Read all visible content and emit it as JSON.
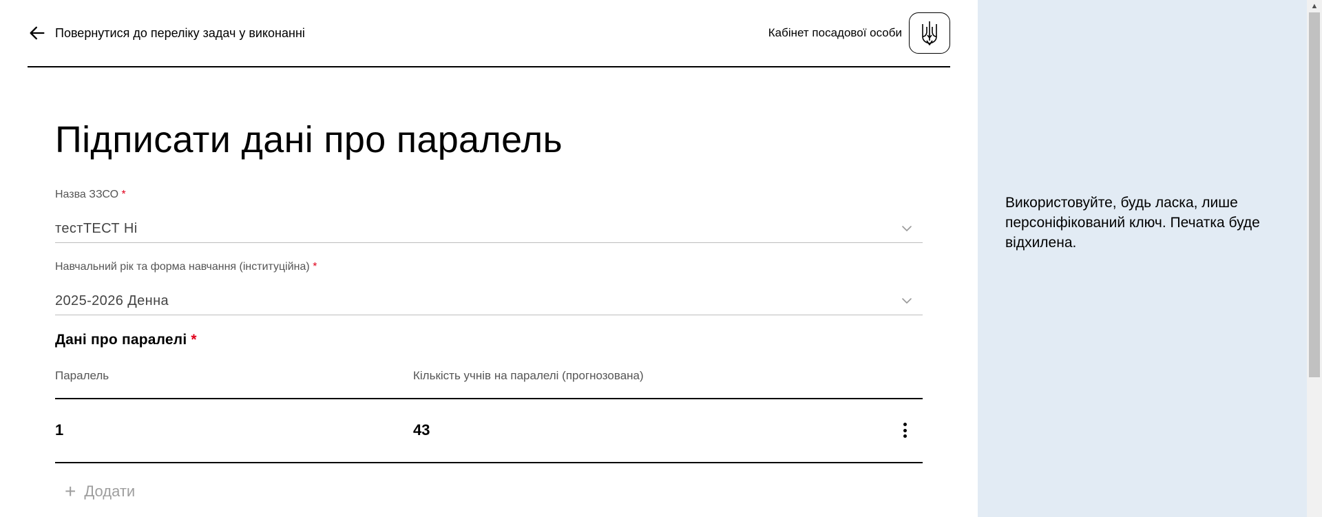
{
  "header": {
    "back_label": "Повернутися до переліку задач у виконанні",
    "cabinet_label": "Кабінет посадової особи"
  },
  "page": {
    "title": "Підписати дані про паралель"
  },
  "form": {
    "school": {
      "label": "Назва ЗЗСО",
      "required_mark": "*",
      "value": "тестТЕСТ Ні"
    },
    "year": {
      "label": "Навчальний рік та форма навчання (інституційна)",
      "required_mark": "*",
      "value": "2025-2026 Денна"
    }
  },
  "parallels": {
    "title": "Дані про паралелі",
    "required_mark": "*",
    "columns": [
      "Паралель",
      "Кількість учнів на паралелі (прогнозована)"
    ],
    "rows": [
      {
        "parallel": "1",
        "students": "43"
      }
    ],
    "add_label": "Додати"
  },
  "sidebar": {
    "note": "Використовуйте, будь ласка, лише персоніфікований ключ. Печатка буде відхилена."
  },
  "colors": {
    "side_bg": "#e2ebf4",
    "required": "#e0001b",
    "muted": "#9e9e9e"
  }
}
